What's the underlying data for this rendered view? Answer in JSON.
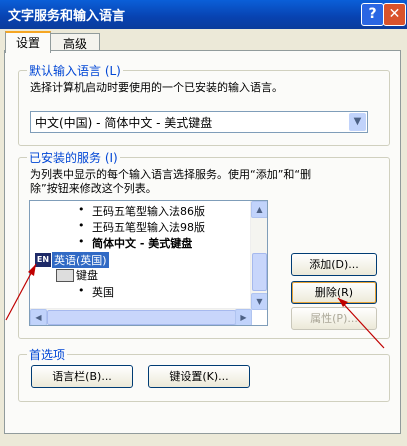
{
  "window": {
    "title": "文字服务和输入语言",
    "help": "?",
    "close": "✕"
  },
  "tabs": [
    "设置",
    "高级"
  ],
  "default_lang": {
    "legend": "默认输入语言 (L)",
    "desc": "选择计算机启动时要使用的一个已安装的输入语言。",
    "selected": "中文(中国) - 简体中文 - 美式键盘"
  },
  "installed": {
    "legend": "已安装的服务 (I)",
    "desc_line1": "为列表中显示的每个输入语言选择服务。使用“添加”和“删",
    "desc_line2": "除”按钮来修改这个列表。"
  },
  "tree": {
    "bullets": [
      "•",
      "•",
      "•",
      "•"
    ],
    "items": [
      "王码五笔型输入法86版",
      "王码五笔型输入法98版",
      "简体中文 - 美式键盘"
    ],
    "lang_badge": "EN",
    "lang": "英语(英国)",
    "kb_label": "键盘",
    "kb_item": "英国"
  },
  "buttons": {
    "add": "添加(D)...",
    "remove": "删除(R)",
    "props": "属性(P)..."
  },
  "prefs": {
    "legend": "首选项",
    "langbar": "语言栏(B)...",
    "keys": "键设置(K)..."
  }
}
